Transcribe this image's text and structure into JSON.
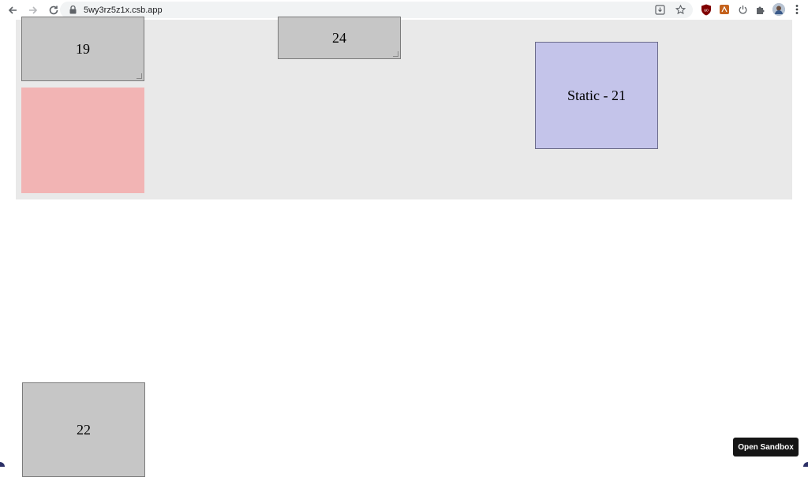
{
  "browser": {
    "url": "5wy3rz5z1x.csb.app"
  },
  "boxes": {
    "box19": "19",
    "box24": "24",
    "static21": "Static - 21",
    "box22": "22"
  },
  "sandbox": {
    "open_label": "Open Sandbox"
  },
  "colors": {
    "canvas_bg": "#e9e9e9",
    "gray_box": "#c6c6c6",
    "pink_box": "#f2b4b4",
    "blue_box": "#c4c4ea",
    "sandbox_btn": "#151515"
  }
}
